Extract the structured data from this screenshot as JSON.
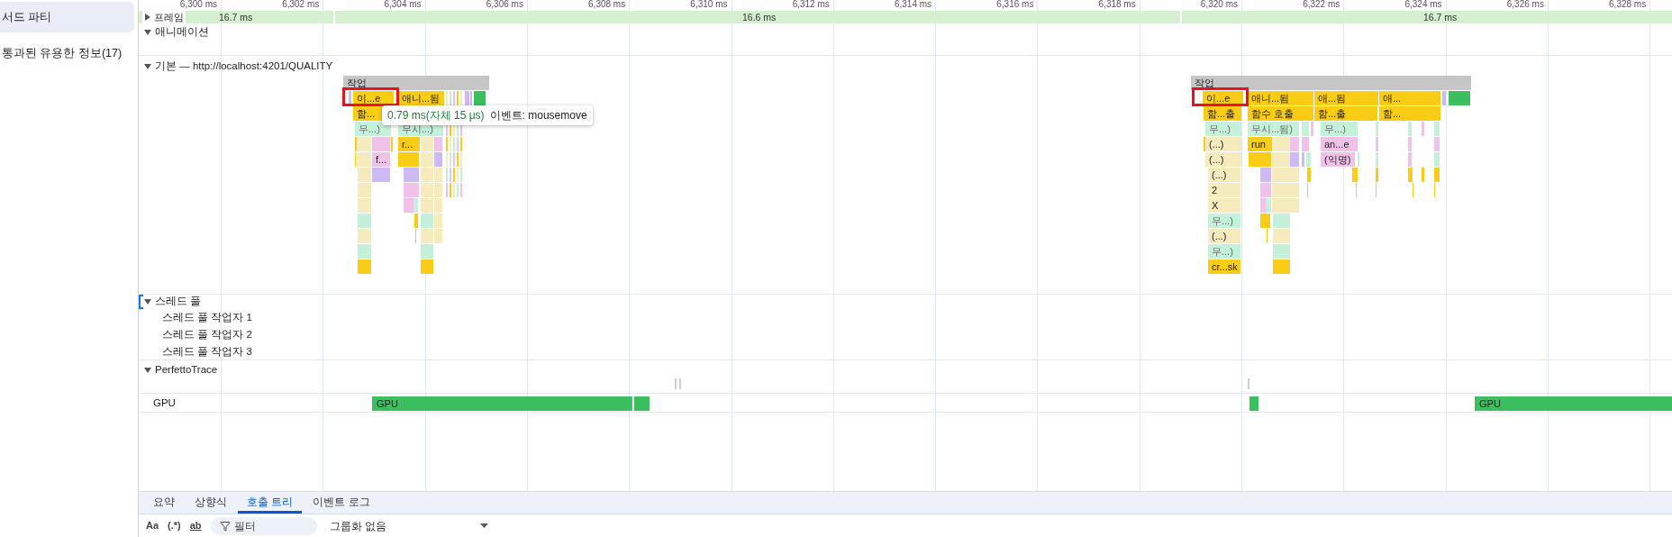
{
  "sidebar": {
    "items": [
      {
        "label": "서드 파티",
        "selected": true
      },
      {
        "label": "통과된 유용한 정보(17)",
        "selected": false
      }
    ]
  },
  "ruler": {
    "ticks": [
      "6,300 ms",
      "6,302 ms",
      "6,304 ms",
      "6,306 ms",
      "6,308 ms",
      "6,310 ms",
      "6,312 ms",
      "6,314 ms",
      "6,316 ms",
      "6,318 ms",
      "6,320 ms",
      "6,322 ms",
      "6,324 ms",
      "6,326 ms",
      "6,328 ms"
    ]
  },
  "frames_track": {
    "label": "프레임",
    "expanded": false,
    "frames": [
      "16.7 ms",
      "16.6 ms",
      "16.7 ms"
    ]
  },
  "animation_track": {
    "label": "애니메이션",
    "expanded": true
  },
  "main_track": {
    "label": "기본 — http://localhost:4201/QUALITY",
    "expanded": true,
    "clusters": [
      {
        "bars": [
          {
            "label": "작업",
            "color": "#c6c6c6",
            "selected": false
          },
          {
            "label": "이...e",
            "color": "#f9cc16",
            "selected": true
          },
          {
            "label": "애니...됨",
            "color": "#f9cc16",
            "selected": false
          },
          {
            "label": "함...",
            "color": "#f9cc16",
            "selected": false
          },
          {
            "label": "무...)",
            "color": "#c3f1d9",
            "selected": false
          },
          {
            "label": "무시...)",
            "color": "#c3f1d9",
            "selected": false
          },
          {
            "label": "r...",
            "color": "#f9cc16",
            "selected": false
          },
          {
            "label": "f...",
            "color": "#f1c2e9",
            "selected": false
          }
        ]
      },
      {
        "bars": [
          {
            "label": "작업",
            "color": "#c6c6c6",
            "selected": false
          },
          {
            "label": "이...e",
            "color": "#f9cc16",
            "selected": true
          },
          {
            "label": "애니...됨",
            "color": "#f9cc16",
            "selected": false
          },
          {
            "label": "애...됨",
            "color": "#f9cc16",
            "selected": false
          },
          {
            "label": "애...",
            "color": "#f9cc16",
            "selected": false
          },
          {
            "label": "함...출",
            "color": "#f9cc16",
            "selected": false
          },
          {
            "label": "함수 호출",
            "color": "#f9cc16",
            "selected": false
          },
          {
            "label": "함...출",
            "color": "#f9cc16",
            "selected": false
          },
          {
            "label": "함...",
            "color": "#f9cc16",
            "selected": false
          },
          {
            "label": "무...)",
            "color": "#c3f1d9",
            "selected": false
          },
          {
            "label": "무시...됨)",
            "color": "#c3f1d9",
            "selected": false
          },
          {
            "label": "무...)",
            "color": "#c3f1d9",
            "selected": false
          },
          {
            "label": "(...)",
            "color": "#f6ebbd",
            "selected": false
          },
          {
            "label": "run",
            "color": "#f9cc16",
            "selected": false
          },
          {
            "label": "an...e",
            "color": "#f1c2e9",
            "selected": false
          },
          {
            "label": "(...)",
            "color": "#f6ebbd",
            "selected": false
          },
          {
            "label": "(익명)",
            "color": "#f1c2e9",
            "selected": false
          },
          {
            "label": "(...)",
            "color": "#f6ebbd",
            "selected": false
          },
          {
            "label": "2",
            "color": "#f6ebbd",
            "selected": false
          },
          {
            "label": "X",
            "color": "#f6ebbd",
            "selected": false
          },
          {
            "label": "무...)",
            "color": "#c3f1d9",
            "selected": false
          },
          {
            "label": "(...)",
            "color": "#f6ebbd",
            "selected": false
          },
          {
            "label": "무...)",
            "color": "#c3f1d9",
            "selected": false
          },
          {
            "label": "cr...sk",
            "color": "#f9cc16",
            "selected": false
          }
        ]
      }
    ],
    "tooltip": {
      "duration": "0.79 ms(자체 15 μs)",
      "event": "이벤트: mousemove"
    }
  },
  "thread_pool": {
    "label": "스레드 풀",
    "expanded": true,
    "focused": true,
    "workers": [
      "스레드 풀 작업자 1",
      "스레드 풀 작업자 2",
      "스레드 풀 작업자 3"
    ]
  },
  "perfetto_track": {
    "label": "PerfettoTrace",
    "expanded": true
  },
  "gpu_track": {
    "label": "GPU",
    "bars": [
      "GPU",
      "GPU"
    ]
  },
  "bottom_tabs": [
    {
      "label": "요약",
      "selected": false
    },
    {
      "label": "상향식",
      "selected": false
    },
    {
      "label": "호출 트리",
      "selected": true
    },
    {
      "label": "이벤트 로그",
      "selected": false
    }
  ],
  "toolbar": {
    "match_case": "Aa",
    "regex": "(.*)",
    "whole_word": "ab",
    "filter": {
      "placeholder": "필터"
    },
    "grouping": "그룹화 없음"
  }
}
